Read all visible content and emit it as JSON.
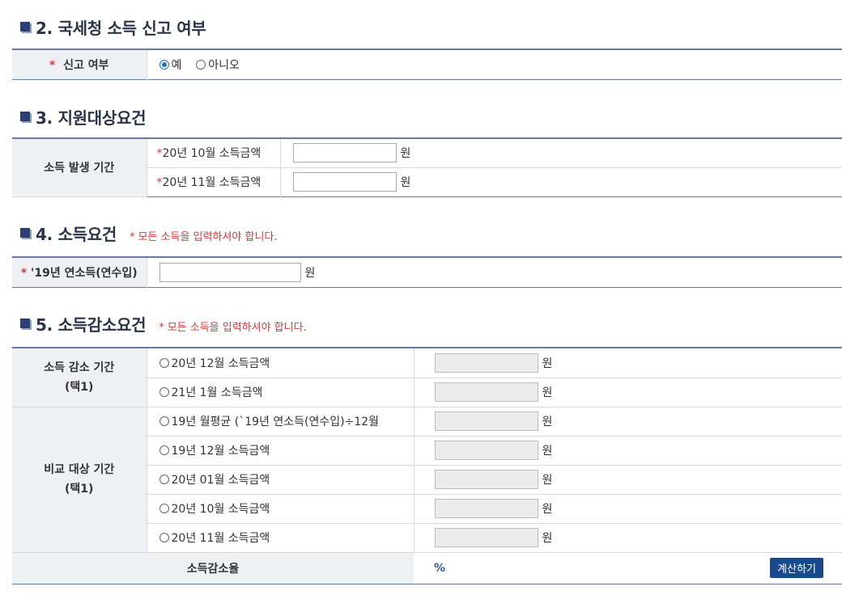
{
  "sec2": {
    "title": "2. 국세청 소득 신고 여부",
    "row_label": "신고 여부",
    "star": "*",
    "options": [
      "예",
      "아니오"
    ]
  },
  "sec3": {
    "title": "3. 지원대상요건",
    "label": "소득 발생 기간",
    "rows": [
      "20년 10월 소득금액",
      "20년 11월 소득금액"
    ]
  },
  "sec4": {
    "title": "4. 소득요건",
    "note": "모든 소득을 입력하셔야 합니다.",
    "row_label": "'19년 연소득(연수입)"
  },
  "sec5": {
    "title": "5. 소득감소요건",
    "note": "모든 소득을 입력하셔야 합니다.",
    "group1_label_line1": "소득 감소 기간",
    "group1_label_line2": "(택1)",
    "group1_rows": [
      "20년 12월 소득금액",
      "21년 1월 소득금액"
    ],
    "group2_label_line1": "비교 대상 기간",
    "group2_label_line2": "(택1)",
    "group2_rows": [
      "19년 월평균 (`19년 연소득(연수입)÷12월",
      "19년 12월 소득금액",
      "20년 01월 소득금액",
      "20년 10월 소득금액",
      "20년 11월 소득금액"
    ],
    "rate_label": "소득감소율",
    "rate_unit": "%",
    "calc_button": "계산하기"
  },
  "common": {
    "won": "원",
    "star": "*"
  },
  "colors": {
    "accent": "#2a3f73",
    "required": "#d23a3a",
    "button": "#1b4a8c"
  }
}
